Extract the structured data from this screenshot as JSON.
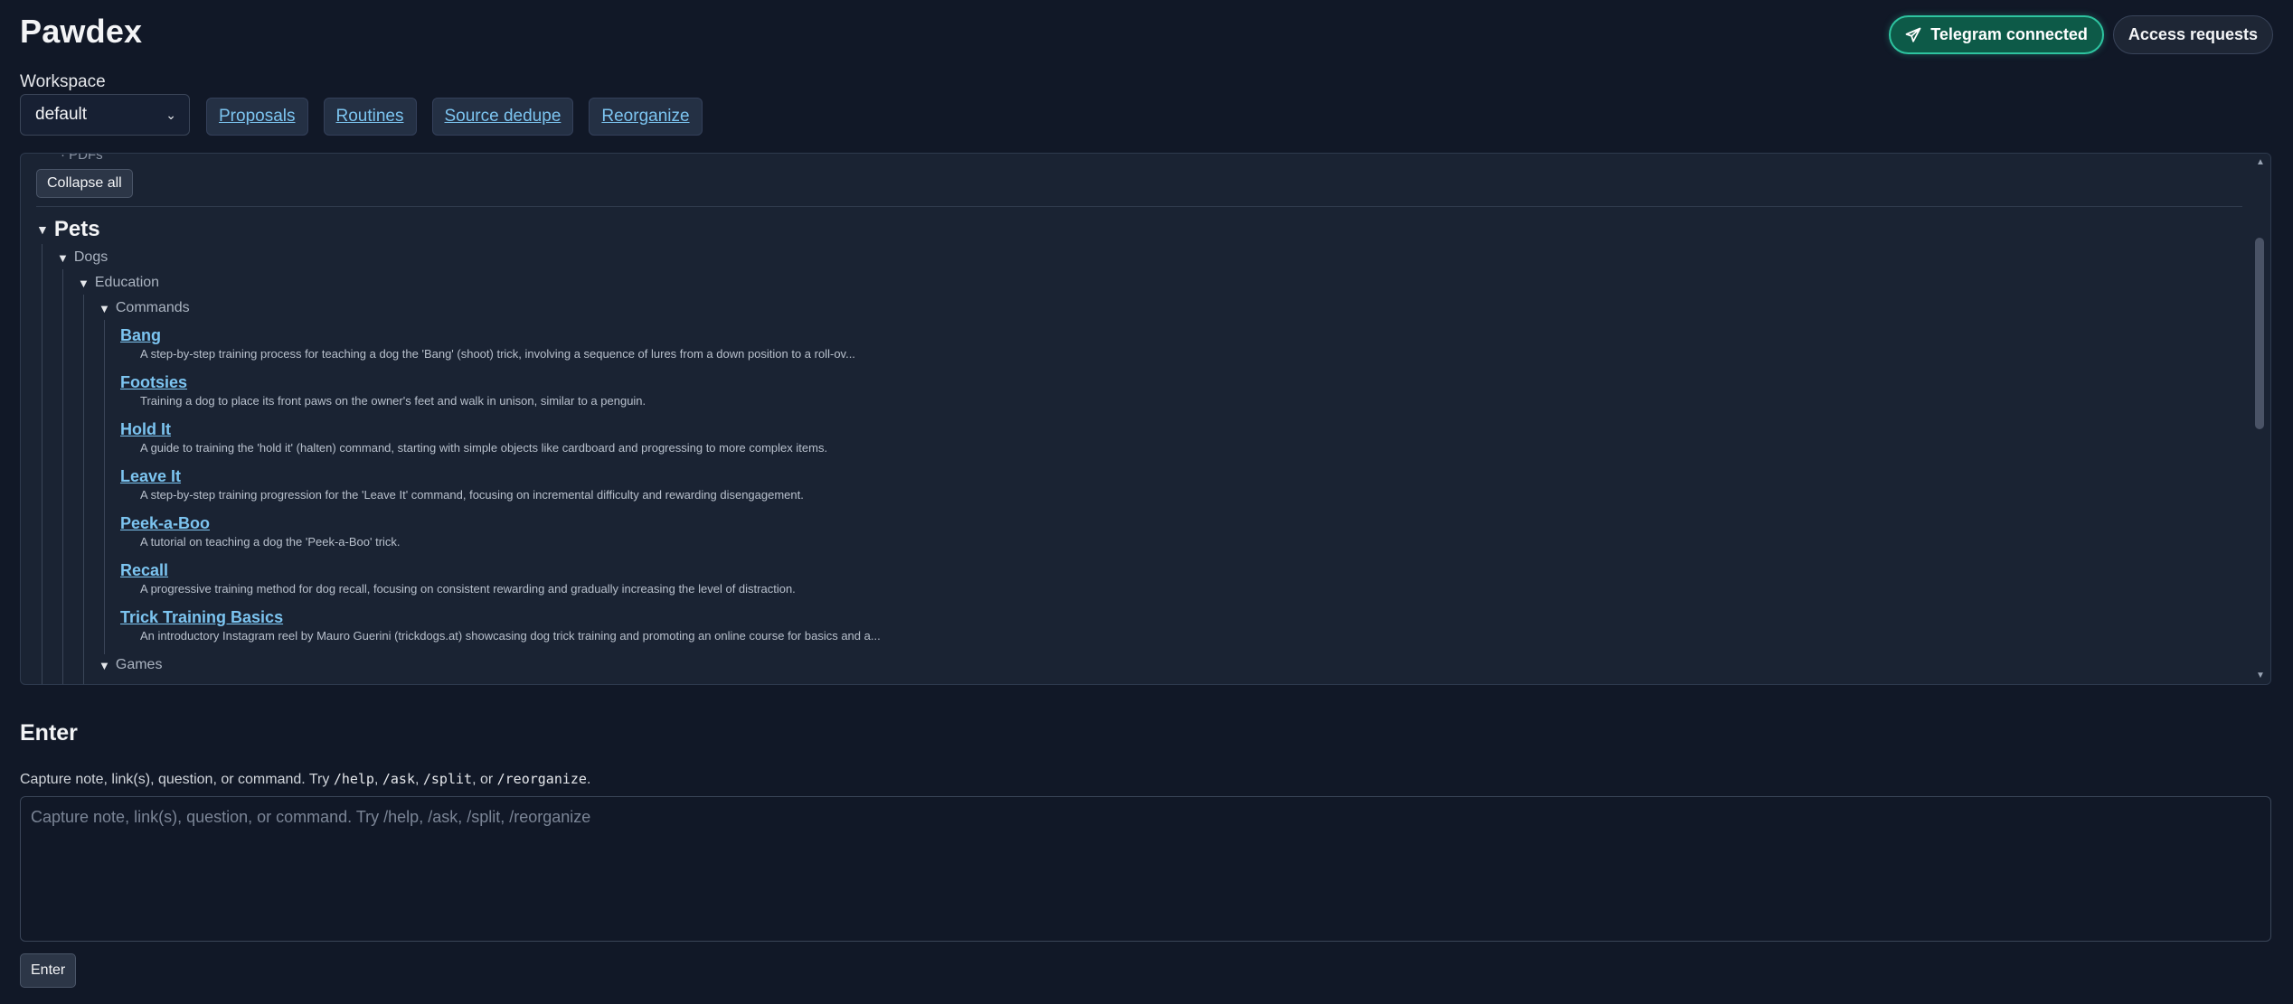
{
  "app": {
    "title": "Pawdex"
  },
  "header": {
    "telegram_label": "Telegram connected",
    "telegram_icon": "paper-plane-icon",
    "access_label": "Access requests"
  },
  "workspace": {
    "label": "Workspace",
    "selected": "default",
    "chevron": "⌄"
  },
  "nav": {
    "proposals": "Proposals",
    "routines": "Routines",
    "source_dedupe": "Source dedupe",
    "reorganize": "Reorganize"
  },
  "tree": {
    "cut_off_item": "PDFs",
    "collapse_all": "Collapse all",
    "expand_marker": "▼",
    "pets": "Pets",
    "dogs": "Dogs",
    "education": "Education",
    "commands": "Commands",
    "entries": [
      {
        "title": "Bang",
        "desc": "A step-by-step training process for teaching a dog the 'Bang' (shoot) trick, involving a sequence of lures from a down position to a roll-ov..."
      },
      {
        "title": "Footsies",
        "desc": "Training a dog to place its front paws on the owner's feet and walk in unison, similar to a penguin."
      },
      {
        "title": "Hold It",
        "desc": "A guide to training the 'hold it' (halten) command, starting with simple objects like cardboard and progressing to more complex items."
      },
      {
        "title": "Leave It",
        "desc": "A step-by-step training progression for the 'Leave It' command, focusing on incremental difficulty and rewarding disengagement."
      },
      {
        "title": "Peek-a-Boo",
        "desc": "A tutorial on teaching a dog the 'Peek-a-Boo' trick."
      },
      {
        "title": "Recall",
        "desc": "A progressive training method for dog recall, focusing on consistent rewarding and gradually increasing the level of distraction."
      },
      {
        "title": "Trick Training Basics",
        "desc": "An introductory Instagram reel by Mauro Guerini (trickdogs.at) showcasing dog trick training and promoting an online course for basics and a..."
      }
    ],
    "games": "Games"
  },
  "enter": {
    "title": "Enter",
    "help_prefix": "Capture note, link(s), question, or command. Try ",
    "cmd_help": "/help",
    "sep1": ", ",
    "cmd_ask": "/ask",
    "sep2": ", ",
    "cmd_split": "/split",
    "sep3": ", or ",
    "cmd_reorganize": "/reorganize",
    "help_suffix": ".",
    "placeholder": "Capture note, link(s), question, or command. Try /help, /ask, /split, /reorganize",
    "button": "Enter"
  },
  "colors": {
    "background": "#111827",
    "panel": "#1a2333",
    "link": "#7cc4f0",
    "telegram_bg": "#0d5a48",
    "telegram_border": "#2ec4a0"
  }
}
